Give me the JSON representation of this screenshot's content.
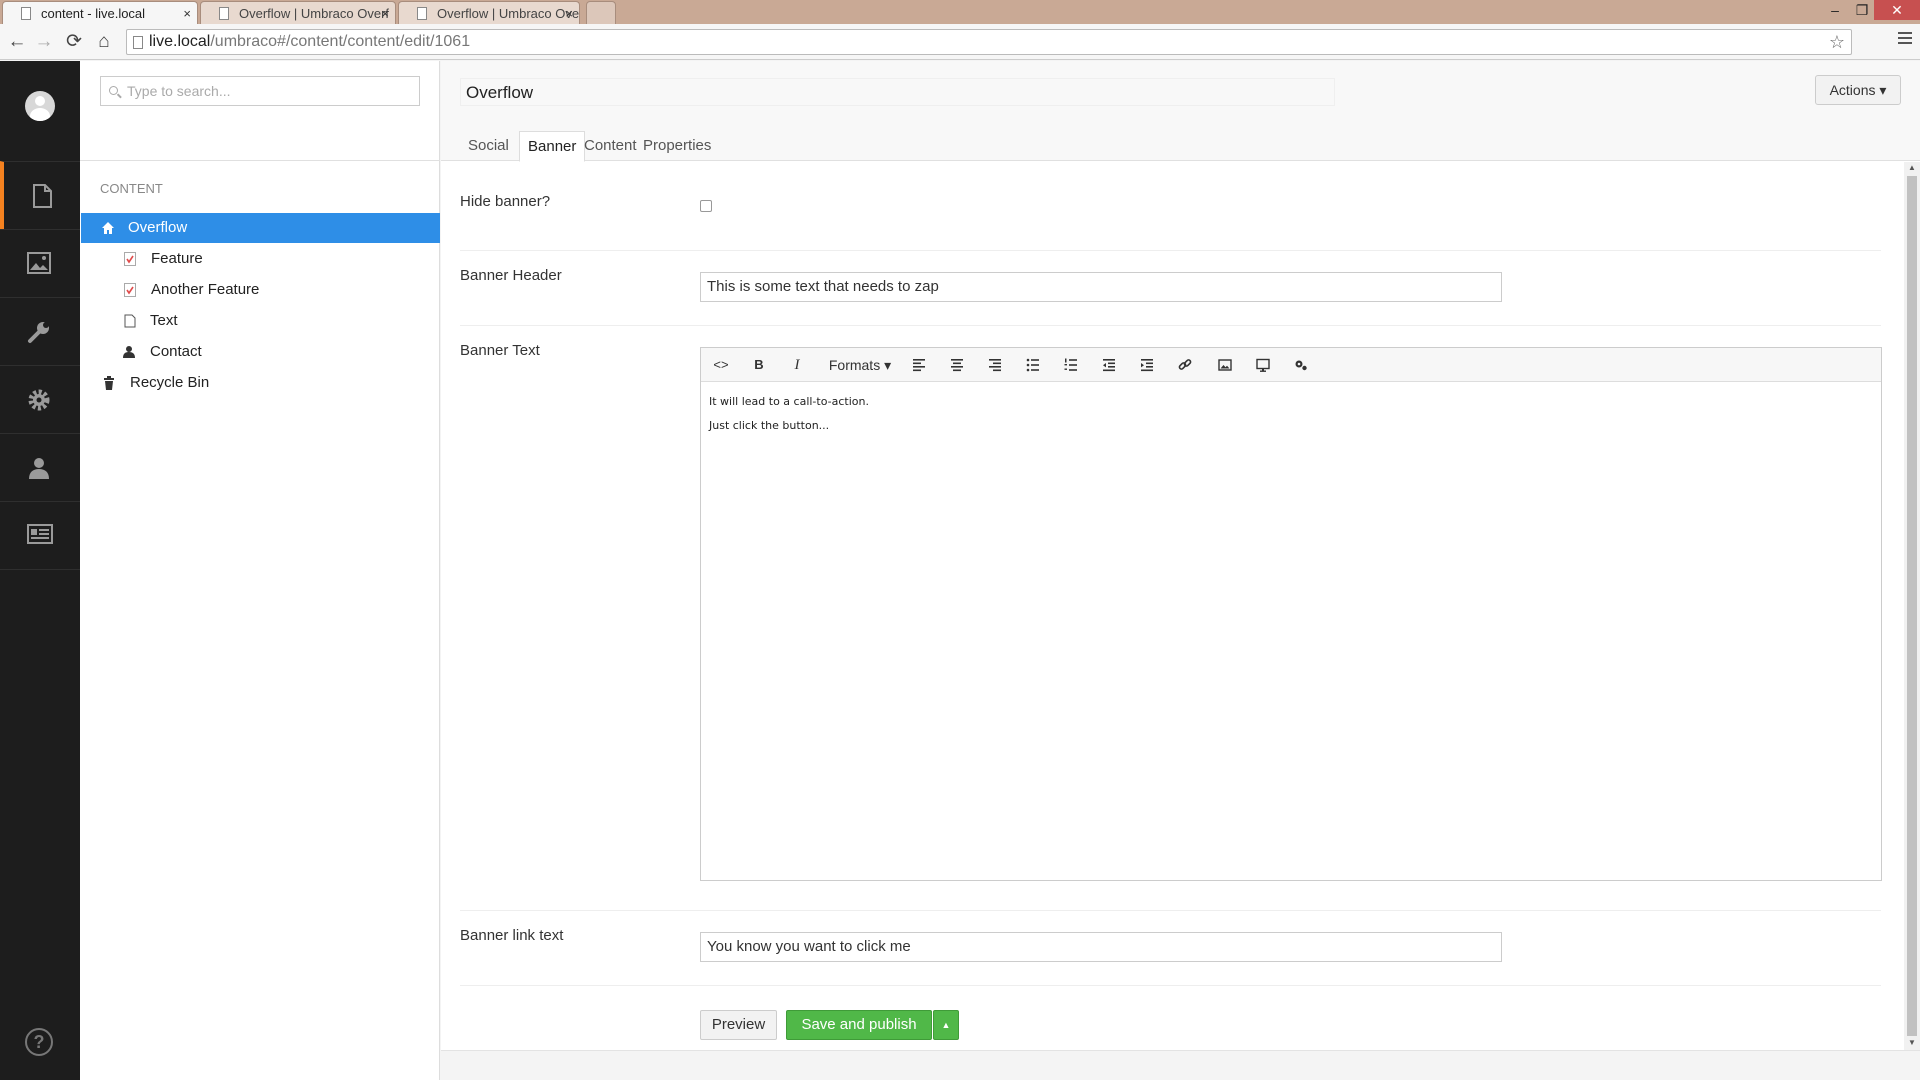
{
  "browser": {
    "tabs": [
      {
        "title": "content - live.local",
        "active": true
      },
      {
        "title": "Overflow | Umbraco Overf",
        "active": false
      },
      {
        "title": "Overflow | Umbraco Overf",
        "active": false
      }
    ],
    "tab_close": "×",
    "url_host": "live.local",
    "url_path": "/umbraco#/content/content/edit/1061",
    "minimize": "–",
    "restore": "❐",
    "close": "✕"
  },
  "tree": {
    "search_placeholder": "Type to search...",
    "title": "CONTENT",
    "nodes": [
      {
        "label": "Overflow",
        "icon": "home-icon"
      },
      {
        "label": "Feature",
        "icon": "feature-doc-icon"
      },
      {
        "label": "Another Feature",
        "icon": "feature-doc-icon"
      },
      {
        "label": "Text",
        "icon": "document-icon"
      },
      {
        "label": "Contact",
        "icon": "user-icon"
      },
      {
        "label": "Recycle Bin",
        "icon": "trash-icon"
      }
    ]
  },
  "editor": {
    "name": "Overflow",
    "actions_label": "Actions ▾",
    "tabs": [
      "Social",
      "Banner",
      "Content",
      "Properties"
    ],
    "active_tab": "Banner",
    "properties": {
      "hide_banner_label": "Hide banner?",
      "banner_header_label": "Banner Header",
      "banner_header_value": "This is some text that needs to zap",
      "banner_text_label": "Banner Text",
      "banner_text_lines": [
        "It will lead to a call-to-action.",
        "Just click the button..."
      ],
      "banner_link_label": "Banner link text",
      "banner_link_value": "You know you want to click me"
    },
    "rte_toolbar": {
      "source": "<>",
      "bold": "B",
      "italic": "I",
      "formats": "Formats ▾"
    },
    "buttons": {
      "preview": "Preview",
      "save_publish": "Save and publish",
      "caret": "▲"
    }
  },
  "colors": {
    "selected": "#2e8ee7",
    "accent": "#f58220",
    "save": "#50b848",
    "appnav": "#1d1d1d"
  }
}
